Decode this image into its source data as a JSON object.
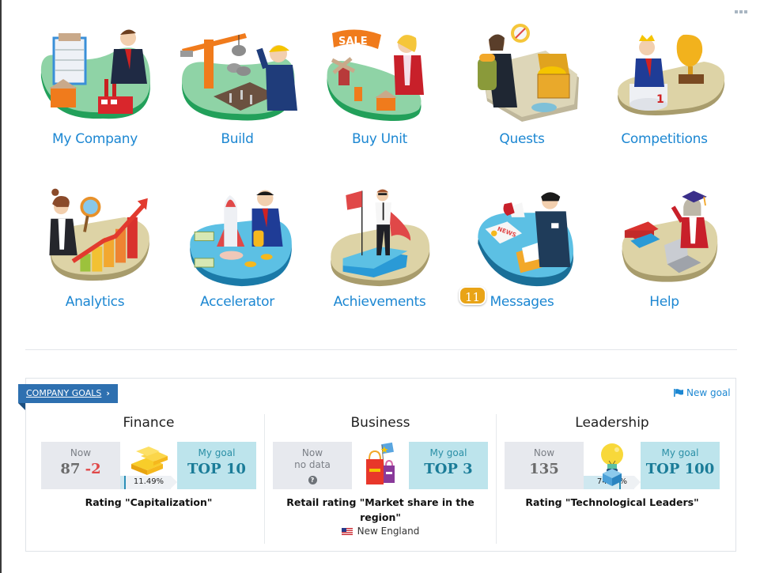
{
  "menu": {
    "more_icon": "ellipsis-icon",
    "tiles": [
      {
        "id": "my-company",
        "label": "My Company",
        "icon": "company-illustration"
      },
      {
        "id": "build",
        "label": "Build",
        "icon": "crane-illustration"
      },
      {
        "id": "buy-unit",
        "label": "Buy Unit",
        "icon": "sale-illustration"
      },
      {
        "id": "quests",
        "label": "Quests",
        "icon": "treasure-chest-illustration"
      },
      {
        "id": "competitions",
        "label": "Competitions",
        "icon": "trophy-illustration"
      },
      {
        "id": "analytics",
        "label": "Analytics",
        "icon": "growth-chart-illustration"
      },
      {
        "id": "accelerator",
        "label": "Accelerator",
        "icon": "rocket-illustration"
      },
      {
        "id": "achievements",
        "label": "Achievements",
        "icon": "flag-hero-illustration"
      },
      {
        "id": "messages",
        "label": "Messages",
        "icon": "megaphone-illustration",
        "badge": "11"
      },
      {
        "id": "help",
        "label": "Help",
        "icon": "graduate-illustration"
      }
    ]
  },
  "goals": {
    "tag_label": "COMPANY GOALS",
    "tag_chevron": "›",
    "new_goal_label": "New goal",
    "new_goal_icon": "flag-icon",
    "colors": {
      "accent": "#1c87d2",
      "tag": "#2e70b0",
      "goal_box": "#bde4ec",
      "now_box": "#e7e9ee",
      "delta_negative": "#e04848"
    },
    "items": [
      {
        "title": "Finance",
        "now_label": "Now",
        "now_value": "87",
        "now_delta": "-2",
        "icon": "gold-bars-icon",
        "progress_label": "11.49%",
        "progress_fraction": 0.1149,
        "goal_label": "My goal",
        "goal_value": "TOP 10",
        "caption": "Rating \"Capitalization\""
      },
      {
        "title": "Business",
        "now_label": "Now",
        "now_nodata": "no data",
        "now_help_icon": "?",
        "icon": "shopping-bags-icon",
        "goal_label": "My goal",
        "goal_value": "TOP 3",
        "caption": "Retail rating \"Market share in the region\"",
        "region": "New England",
        "region_icon": "us-flag-icon"
      },
      {
        "title": "Leadership",
        "now_label": "Now",
        "now_value": "135",
        "icon": "light-bulb-icon",
        "progress_label": "74.07%",
        "progress_fraction": 0.7407,
        "goal_label": "My goal",
        "goal_value": "TOP 100",
        "caption": "Rating \"Technological Leaders\""
      }
    ]
  }
}
